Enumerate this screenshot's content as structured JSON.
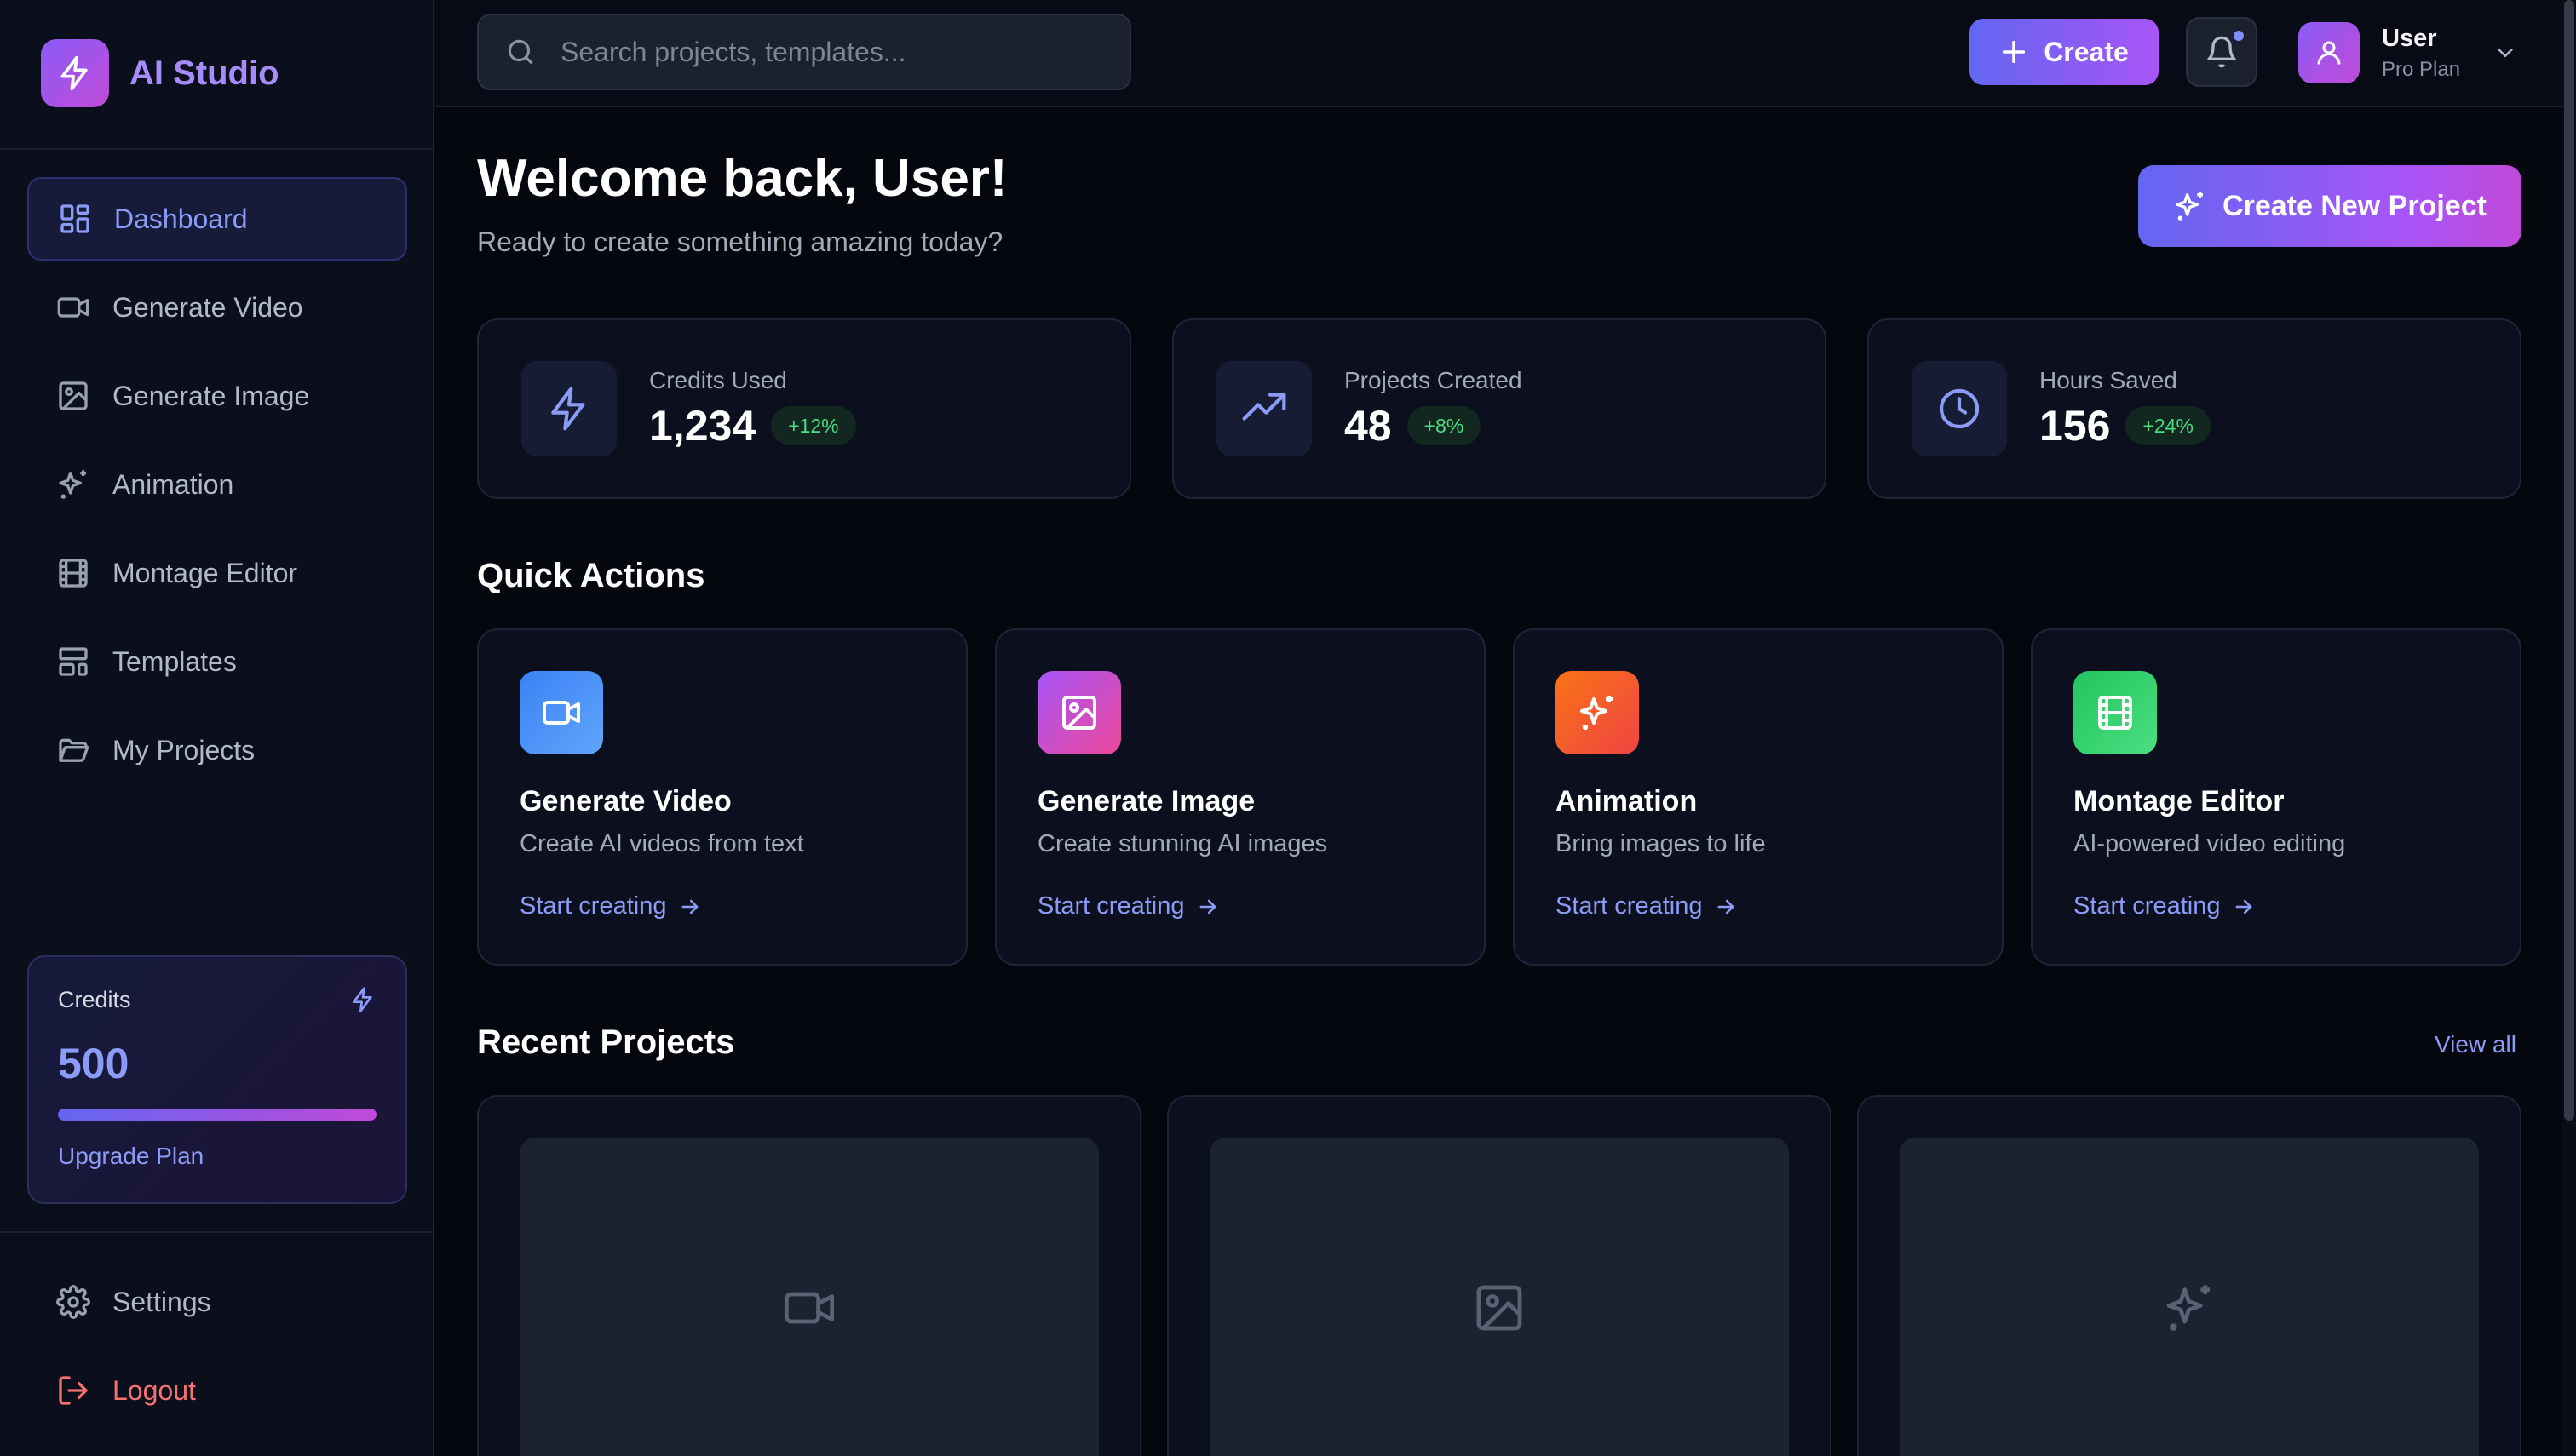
{
  "app": {
    "name": "AI Studio"
  },
  "sidebar": {
    "items": [
      {
        "label": "Dashboard",
        "icon": "dashboard-icon",
        "active": true
      },
      {
        "label": "Generate Video",
        "icon": "video-icon"
      },
      {
        "label": "Generate Image",
        "icon": "image-icon"
      },
      {
        "label": "Animation",
        "icon": "sparkles-icon"
      },
      {
        "label": "Montage Editor",
        "icon": "film-icon"
      },
      {
        "label": "Templates",
        "icon": "templates-icon"
      },
      {
        "label": "My Projects",
        "icon": "folder-icon"
      }
    ],
    "credits": {
      "label": "Credits",
      "value": "500",
      "fill": 1.0,
      "upgrade": "Upgrade Plan"
    },
    "bottom": [
      {
        "label": "Settings",
        "icon": "gear-icon"
      },
      {
        "label": "Logout",
        "icon": "logout-icon"
      }
    ]
  },
  "header": {
    "search_placeholder": "Search projects, templates...",
    "create_label": "Create",
    "user": {
      "name": "User",
      "plan": "Pro Plan"
    }
  },
  "main": {
    "welcome": "Welcome back, User!",
    "subtitle": "Ready to create something amazing today?",
    "new_project_label": "Create New Project",
    "stats": [
      {
        "label": "Credits Used",
        "value": "1,234",
        "change": "+12%",
        "icon": "lightning-icon"
      },
      {
        "label": "Projects Created",
        "value": "48",
        "change": "+8%",
        "icon": "trending-up-icon"
      },
      {
        "label": "Hours Saved",
        "value": "156",
        "change": "+24%",
        "icon": "clock-icon"
      }
    ],
    "quick_actions_title": "Quick Actions",
    "quick_actions": [
      {
        "title": "Generate Video",
        "desc": "Create AI videos from text",
        "link": "Start creating",
        "icon": "video-icon",
        "colors": [
          "#3b82f6",
          "#60a5fa"
        ]
      },
      {
        "title": "Generate Image",
        "desc": "Create stunning AI images",
        "link": "Start creating",
        "icon": "image-icon",
        "colors": [
          "#a855f7",
          "#ec4899"
        ]
      },
      {
        "title": "Animation",
        "desc": "Bring images to life",
        "link": "Start creating",
        "icon": "sparkles-icon",
        "colors": [
          "#f97316",
          "#ef4444"
        ]
      },
      {
        "title": "Montage Editor",
        "desc": "AI-powered video editing",
        "link": "Start creating",
        "icon": "film-icon",
        "colors": [
          "#22c55e",
          "#4ade80"
        ]
      }
    ],
    "recent_title": "Recent Projects",
    "view_all": "View all",
    "recent_projects": [
      {
        "icon": "video-icon"
      },
      {
        "icon": "image-icon"
      },
      {
        "icon": "sparkles-icon"
      }
    ]
  },
  "colors": {
    "accent": "#8c9cf6",
    "brand_start": "#6366f1",
    "brand_end": "#c04ad8",
    "danger": "#f87171",
    "success": "#4ade80"
  }
}
